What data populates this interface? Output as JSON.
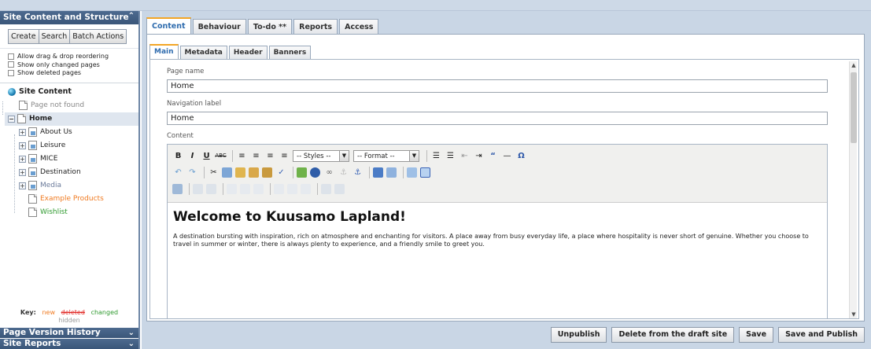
{
  "sidebar": {
    "title": "Site Content and Structure",
    "buttons": [
      "Create",
      "Search",
      "Batch Actions"
    ],
    "options": [
      "Allow drag & drop reordering",
      "Show only changed pages",
      "Show deleted pages"
    ],
    "tree_root": "Site Content",
    "tree": {
      "page_not_found": "Page not found",
      "home": "Home",
      "about": "About Us",
      "leisure": "Leisure",
      "mice": "MICE",
      "destination": "Destination",
      "media": "Media",
      "example": "Example Products",
      "wishlist": "Wishlist"
    },
    "key": {
      "label": "Key:",
      "new": "new",
      "deleted": "deleted",
      "changed": "changed",
      "hidden": "hidden"
    },
    "footer1": "Page Version History",
    "footer2": "Site Reports"
  },
  "tabs": [
    "Content",
    "Behaviour",
    "To-do **",
    "Reports",
    "Access"
  ],
  "subtabs": [
    "Main",
    "Metadata",
    "Header",
    "Banners"
  ],
  "form": {
    "page_name_label": "Page name",
    "page_name": "Home",
    "nav_label": "Navigation label",
    "nav_value": "Home",
    "content_label": "Content"
  },
  "editor": {
    "styles": "-- Styles --",
    "format": "-- Format --",
    "heading": "Welcome to Kuusamo Lapland!",
    "paragraph": "A destination bursting with inspiration, rich on atmosphere and enchanting for visitors. A place away from busy everyday life, a place where hospitality is never short of genuine. Whether you choose to travel in summer or winter, there is always plenty to experience, and a friendly smile to greet you."
  },
  "actions": [
    "Unpublish",
    "Delete from the draft site",
    "Save",
    "Save and Publish"
  ],
  "colors": {
    "new": "#f07b22",
    "deleted": "#e0221e",
    "changed": "#2f9a2f",
    "hidden": "#999999",
    "active_tab_border": "#f3a626"
  }
}
